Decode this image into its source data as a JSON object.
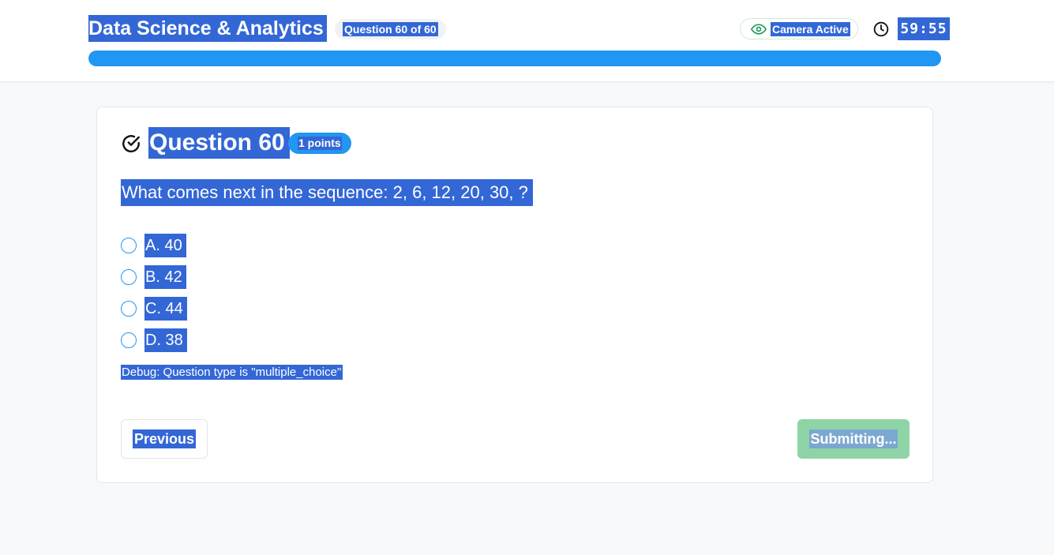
{
  "header": {
    "course_title": "Data Science & Analytics",
    "question_counter": "Question 60 of 60",
    "camera_status": "Camera Active",
    "timer": "59:55",
    "progress_percent": 100,
    "icons": {
      "camera": "eye-icon",
      "timer": "clock-icon"
    }
  },
  "question": {
    "title": "Question 60",
    "points_badge": "1 points",
    "text": "What comes next in the sequence: 2, 6, 12, 20, 30, ?",
    "options": [
      {
        "label": "A. 40"
      },
      {
        "label": "B. 42"
      },
      {
        "label": "C. 44"
      },
      {
        "label": "D. 38"
      }
    ],
    "debug": "Debug: Question type is \"multiple_choice\"",
    "icon": "check-circle-icon"
  },
  "navigation": {
    "previous_label": "Previous",
    "submit_label": "Submitting..."
  },
  "colors": {
    "accent": "#2196f3",
    "submit_disabled": "#8fd4a6",
    "camera_green": "#1f9d55",
    "selection": "#3367d6"
  }
}
